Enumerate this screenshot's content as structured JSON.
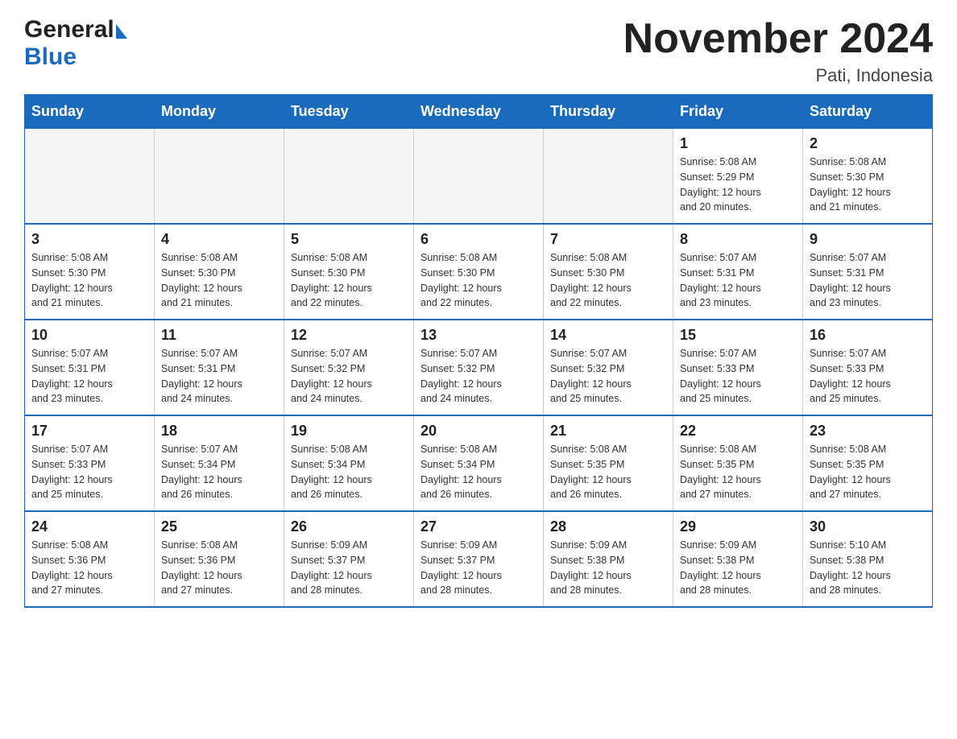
{
  "header": {
    "logo_general": "General",
    "logo_blue": "Blue",
    "title": "November 2024",
    "subtitle": "Pati, Indonesia"
  },
  "days_of_week": [
    "Sunday",
    "Monday",
    "Tuesday",
    "Wednesday",
    "Thursday",
    "Friday",
    "Saturday"
  ],
  "weeks": [
    [
      {
        "day": "",
        "info": ""
      },
      {
        "day": "",
        "info": ""
      },
      {
        "day": "",
        "info": ""
      },
      {
        "day": "",
        "info": ""
      },
      {
        "day": "",
        "info": ""
      },
      {
        "day": "1",
        "info": "Sunrise: 5:08 AM\nSunset: 5:29 PM\nDaylight: 12 hours\nand 20 minutes."
      },
      {
        "day": "2",
        "info": "Sunrise: 5:08 AM\nSunset: 5:30 PM\nDaylight: 12 hours\nand 21 minutes."
      }
    ],
    [
      {
        "day": "3",
        "info": "Sunrise: 5:08 AM\nSunset: 5:30 PM\nDaylight: 12 hours\nand 21 minutes."
      },
      {
        "day": "4",
        "info": "Sunrise: 5:08 AM\nSunset: 5:30 PM\nDaylight: 12 hours\nand 21 minutes."
      },
      {
        "day": "5",
        "info": "Sunrise: 5:08 AM\nSunset: 5:30 PM\nDaylight: 12 hours\nand 22 minutes."
      },
      {
        "day": "6",
        "info": "Sunrise: 5:08 AM\nSunset: 5:30 PM\nDaylight: 12 hours\nand 22 minutes."
      },
      {
        "day": "7",
        "info": "Sunrise: 5:08 AM\nSunset: 5:30 PM\nDaylight: 12 hours\nand 22 minutes."
      },
      {
        "day": "8",
        "info": "Sunrise: 5:07 AM\nSunset: 5:31 PM\nDaylight: 12 hours\nand 23 minutes."
      },
      {
        "day": "9",
        "info": "Sunrise: 5:07 AM\nSunset: 5:31 PM\nDaylight: 12 hours\nand 23 minutes."
      }
    ],
    [
      {
        "day": "10",
        "info": "Sunrise: 5:07 AM\nSunset: 5:31 PM\nDaylight: 12 hours\nand 23 minutes."
      },
      {
        "day": "11",
        "info": "Sunrise: 5:07 AM\nSunset: 5:31 PM\nDaylight: 12 hours\nand 24 minutes."
      },
      {
        "day": "12",
        "info": "Sunrise: 5:07 AM\nSunset: 5:32 PM\nDaylight: 12 hours\nand 24 minutes."
      },
      {
        "day": "13",
        "info": "Sunrise: 5:07 AM\nSunset: 5:32 PM\nDaylight: 12 hours\nand 24 minutes."
      },
      {
        "day": "14",
        "info": "Sunrise: 5:07 AM\nSunset: 5:32 PM\nDaylight: 12 hours\nand 25 minutes."
      },
      {
        "day": "15",
        "info": "Sunrise: 5:07 AM\nSunset: 5:33 PM\nDaylight: 12 hours\nand 25 minutes."
      },
      {
        "day": "16",
        "info": "Sunrise: 5:07 AM\nSunset: 5:33 PM\nDaylight: 12 hours\nand 25 minutes."
      }
    ],
    [
      {
        "day": "17",
        "info": "Sunrise: 5:07 AM\nSunset: 5:33 PM\nDaylight: 12 hours\nand 25 minutes."
      },
      {
        "day": "18",
        "info": "Sunrise: 5:07 AM\nSunset: 5:34 PM\nDaylight: 12 hours\nand 26 minutes."
      },
      {
        "day": "19",
        "info": "Sunrise: 5:08 AM\nSunset: 5:34 PM\nDaylight: 12 hours\nand 26 minutes."
      },
      {
        "day": "20",
        "info": "Sunrise: 5:08 AM\nSunset: 5:34 PM\nDaylight: 12 hours\nand 26 minutes."
      },
      {
        "day": "21",
        "info": "Sunrise: 5:08 AM\nSunset: 5:35 PM\nDaylight: 12 hours\nand 26 minutes."
      },
      {
        "day": "22",
        "info": "Sunrise: 5:08 AM\nSunset: 5:35 PM\nDaylight: 12 hours\nand 27 minutes."
      },
      {
        "day": "23",
        "info": "Sunrise: 5:08 AM\nSunset: 5:35 PM\nDaylight: 12 hours\nand 27 minutes."
      }
    ],
    [
      {
        "day": "24",
        "info": "Sunrise: 5:08 AM\nSunset: 5:36 PM\nDaylight: 12 hours\nand 27 minutes."
      },
      {
        "day": "25",
        "info": "Sunrise: 5:08 AM\nSunset: 5:36 PM\nDaylight: 12 hours\nand 27 minutes."
      },
      {
        "day": "26",
        "info": "Sunrise: 5:09 AM\nSunset: 5:37 PM\nDaylight: 12 hours\nand 28 minutes."
      },
      {
        "day": "27",
        "info": "Sunrise: 5:09 AM\nSunset: 5:37 PM\nDaylight: 12 hours\nand 28 minutes."
      },
      {
        "day": "28",
        "info": "Sunrise: 5:09 AM\nSunset: 5:38 PM\nDaylight: 12 hours\nand 28 minutes."
      },
      {
        "day": "29",
        "info": "Sunrise: 5:09 AM\nSunset: 5:38 PM\nDaylight: 12 hours\nand 28 minutes."
      },
      {
        "day": "30",
        "info": "Sunrise: 5:10 AM\nSunset: 5:38 PM\nDaylight: 12 hours\nand 28 minutes."
      }
    ]
  ]
}
